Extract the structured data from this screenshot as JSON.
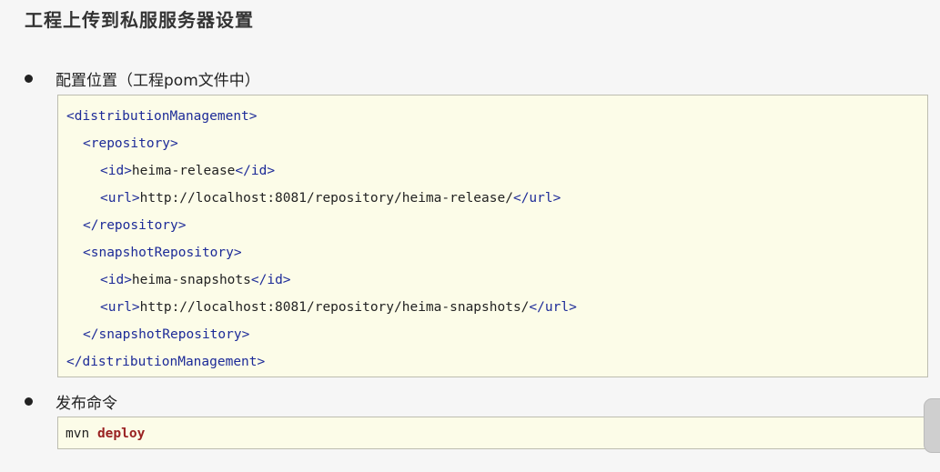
{
  "page": {
    "title": "工程上传到私服服务器设置"
  },
  "sections": {
    "config_label": "配置位置（工程pom文件中）",
    "deploy_label": "发布命令"
  },
  "xml": {
    "dm_open": "<distributionManagement>",
    "repo_open": "<repository>",
    "repo_id_open": "<id>",
    "repo_id_value": "heima-release",
    "repo_id_close": "</id>",
    "repo_url_open": "<url>",
    "repo_url_value": "http://localhost:8081/repository/heima-release/",
    "repo_url_close": "</url>",
    "repo_close": "</repository>",
    "snap_open": "<snapshotRepository>",
    "snap_id_open": "<id>",
    "snap_id_value": "heima-snapshots",
    "snap_id_close": "</id>",
    "snap_url_open": "<url>",
    "snap_url_value": "http://localhost:8081/repository/heima-snapshots/",
    "snap_url_close": "</url>",
    "snap_close": "</snapshotRepository>",
    "dm_close": "</distributionManagement>"
  },
  "command": {
    "tool": "mvn",
    "goal": "deploy"
  },
  "colors": {
    "page_background": "#f6f6f6",
    "code_background": "#fcfce8",
    "code_border": "#bdbdb0",
    "xml_tag": "#1d2b98",
    "keyword": "#9a2222"
  }
}
